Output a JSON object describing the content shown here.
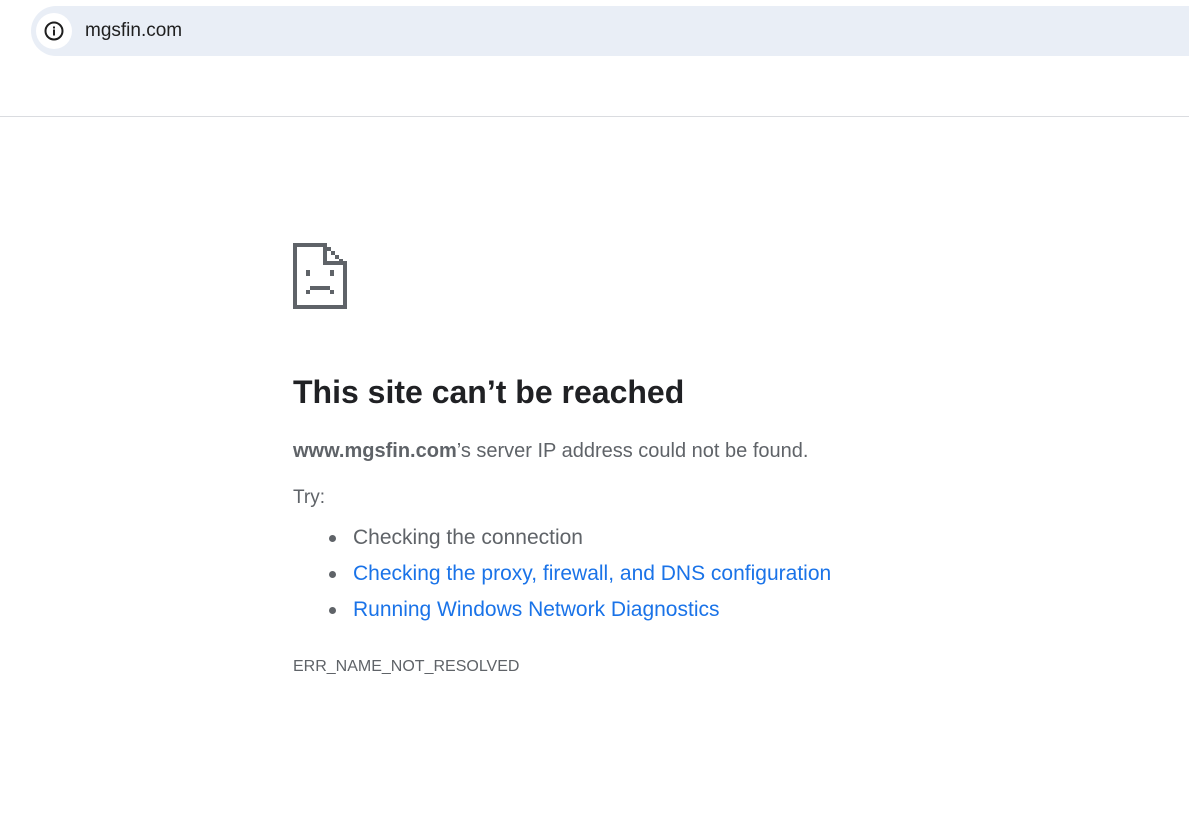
{
  "addressbar": {
    "site_info_icon": "info-circle-icon",
    "url": "mgsfin.com"
  },
  "error": {
    "icon": "sad-page-icon",
    "title": "This site can’t be reached",
    "host": "www.mgsfin.com",
    "summary_rest": "’s server IP address could not be found.",
    "try_label": "Try:",
    "suggestions": [
      {
        "label": "Checking the connection",
        "link": false
      },
      {
        "label": "Checking the proxy, firewall, and DNS configuration",
        "link": true
      },
      {
        "label": "Running Windows Network Diagnostics",
        "link": true
      }
    ],
    "code": "ERR_NAME_NOT_RESOLVED"
  },
  "colors": {
    "addressbar_bg": "#e9eef6",
    "link": "#1a73e8",
    "text_secondary": "#5f6368",
    "heading": "#202124"
  }
}
